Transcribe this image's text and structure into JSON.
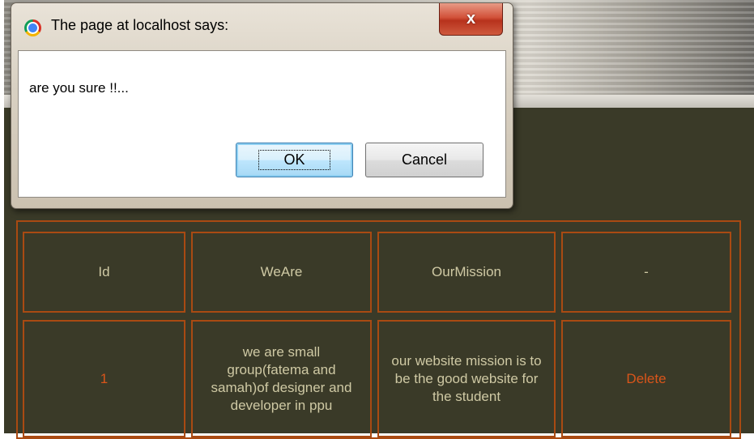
{
  "dialog": {
    "title": "The page at localhost says:",
    "close_glyph": "x",
    "message": "are you sure !!...",
    "ok_label": "OK",
    "cancel_label": "Cancel"
  },
  "table": {
    "headers": [
      "Id",
      "WeAre",
      "OurMission",
      "-"
    ],
    "rows": [
      {
        "id": "1",
        "we_are": "we are small group(fatema and samah)of designer and developer in ppu",
        "our_mission": "our website mission is to be the good website for the student",
        "action": "Delete"
      }
    ]
  },
  "colors": {
    "page_background": "#3a3a28",
    "table_border": "#a94a12",
    "header_text": "#cfc9a4",
    "accent_text": "#d9551a"
  },
  "icons": {
    "browser": "chrome-icon",
    "close": "close-icon"
  }
}
